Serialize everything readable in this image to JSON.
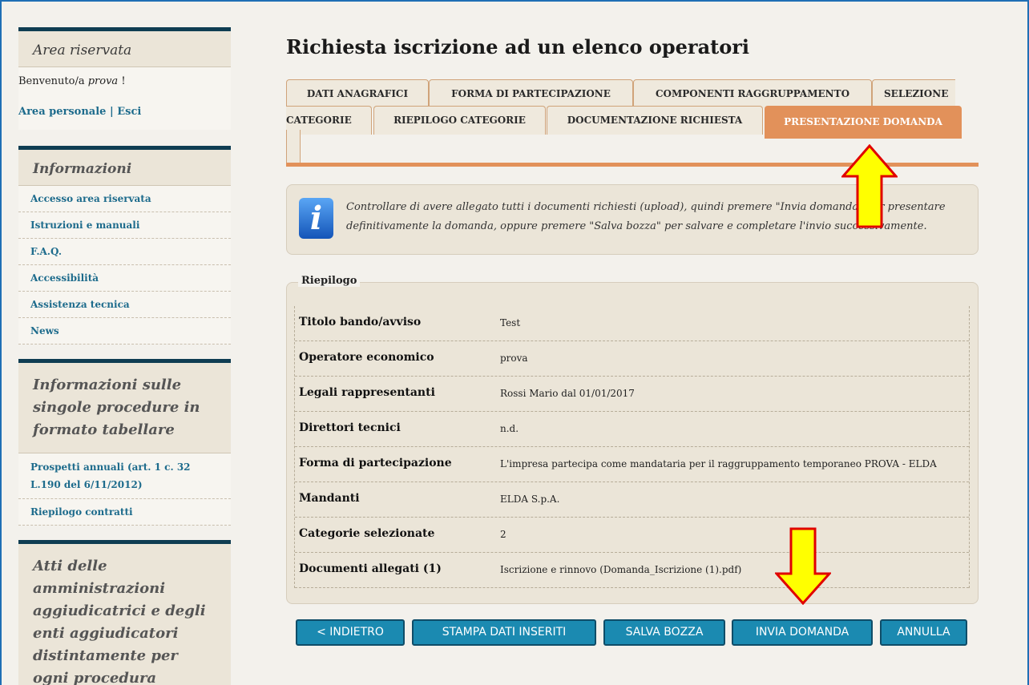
{
  "sidebar": {
    "reserved": {
      "title": "Area riservata",
      "welcome_prefix": "Benvenuto/a ",
      "user": "prova",
      "welcome_suffix": " !",
      "personal_area": "Area personale",
      "separator": " | ",
      "logout": "Esci"
    },
    "info": {
      "title": "Informazioni",
      "items": [
        "Accesso area riservata",
        "Istruzioni e manuali",
        "F.A.Q.",
        "Accessibilità",
        "Assistenza tecnica",
        "News"
      ]
    },
    "procedures": {
      "title": "Informazioni sulle singole procedure in formato tabellare",
      "items": [
        "Prospetti annuali (art. 1 c. 32 L.190 del 6/11/2012)",
        "Riepilogo contratti"
      ]
    },
    "acts": {
      "title": "Atti delle amministrazioni aggiudicatrici e degli enti aggiudicatori distintamente per ogni procedura"
    }
  },
  "page": {
    "title": "Richiesta iscrizione ad un elenco operatori"
  },
  "tabs": {
    "row1": [
      "DATI ANAGRAFICI",
      "FORMA DI PARTECIPAZIONE",
      "COMPONENTI RAGGRUPPAMENTO",
      "SELEZIONE"
    ],
    "row2": [
      "CATEGORIE",
      "RIEPILOGO CATEGORIE",
      "DOCUMENTAZIONE RICHIESTA",
      "PRESENTAZIONE DOMANDA"
    ]
  },
  "info": {
    "icon": "info-icon",
    "line1": "Controllare di avere allegato tutti i documenti richiesti (upload), quindi premere \"Invia domanda\" per presentare",
    "line2": "definitivamente la domanda, oppure premere \"Salva bozza\" per salvare e completare l'invio successivamente."
  },
  "summary": {
    "legend": "Riepilogo",
    "rows": [
      {
        "label": "Titolo bando/avviso",
        "value": "Test"
      },
      {
        "label": "Operatore economico",
        "value": "prova"
      },
      {
        "label": "Legali rappresentanti",
        "value": "Rossi Mario dal 01/01/2017"
      },
      {
        "label": "Direttori tecnici",
        "value": "n.d."
      },
      {
        "label": "Forma di partecipazione",
        "value": "L'impresa partecipa come mandataria per il raggruppamento temporaneo PROVA - ELDA"
      },
      {
        "label": "Mandanti",
        "value": "ELDA S.p.A."
      },
      {
        "label": "Categorie selezionate",
        "value": "2"
      },
      {
        "label": "Documenti allegati (1)",
        "value": "Iscrizione e rinnovo (Domanda_Iscrizione (1).pdf)"
      }
    ]
  },
  "buttons": {
    "back": "< INDIETRO",
    "print": "STAMPA DATI INSERITI",
    "save": "SALVA BOZZA",
    "send": "INVIA DOMANDA",
    "cancel": "ANNULLA"
  },
  "colors": {
    "accent": "#e2915a",
    "button": "#1b8ab1",
    "sidebar_border": "#0f3d52",
    "link": "#1d6b8c",
    "arrow_fill": "#ffff00",
    "arrow_stroke": "#e00000"
  }
}
